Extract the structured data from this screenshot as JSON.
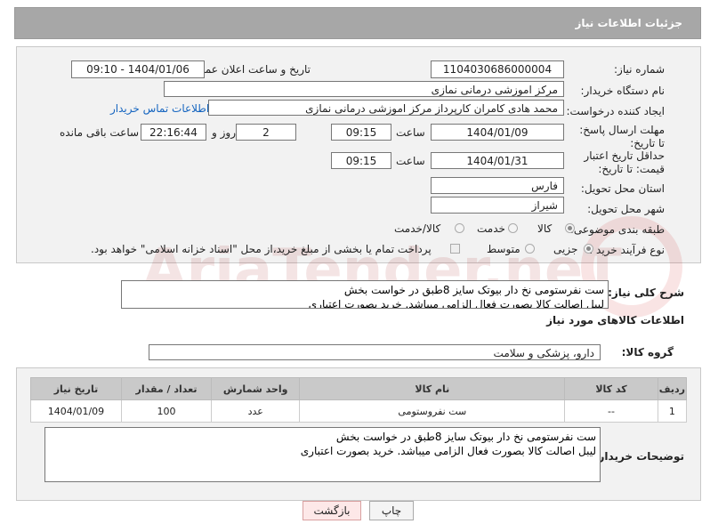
{
  "header": {
    "title": "جزئیات اطلاعات نیاز"
  },
  "form": {
    "need_number_label": "شماره نیاز:",
    "need_number": "1104030686000004",
    "announce_label": "تاریخ و ساعت اعلان عمومی:",
    "announce_value": "1404/01/06 - 09:10",
    "buyer_org_label": "نام دستگاه خریدار:",
    "buyer_org": "مرکز اموزشی درمانی نمازی",
    "creator_label": "ایجاد کننده درخواست:",
    "creator": "محمد هادی کامران کارپرداز مرکز اموزشی درمانی نمازی",
    "contact_link": "اطلاعات تماس خریدار",
    "reply_deadline_label": "مهلت ارسال پاسخ: تا تاریخ:",
    "reply_date": "1404/01/09",
    "time_label": "ساعت",
    "reply_time": "09:15",
    "days_count": "2",
    "days_and_label": "روز و",
    "remaining_time": "22:16:44",
    "remaining_label": "ساعت باقی مانده",
    "price_validity_label": "حداقل تاریخ اعتبار قیمت: تا تاریخ:",
    "price_date": "1404/01/31",
    "price_time": "09:15",
    "province_label": "استان محل تحویل:",
    "province": "فارس",
    "city_label": "شهر محل تحویل:",
    "city": "شیراز",
    "category_label": "طبقه بندی موضوعی:",
    "category_options": [
      "کالا",
      "خدمت",
      "کالا/خدمت"
    ],
    "process_label": "نوع فرآیند خرید :",
    "process_options": [
      "جزیی",
      "متوسط"
    ],
    "payment_note": "پرداخت تمام یا بخشی از مبلغ خرید،از محل \"اسناد خزانه اسلامی\" خواهد بود."
  },
  "general_desc": {
    "label": "شرح کلی نیاز:",
    "text": "ست نفرستومی نخ دار بیوتک سایز 8طبق در خواست بخش\nلیبل اصالت کالا بصورت فعال الزامی میباشد. خرید بصورت اعتباری"
  },
  "goods_info": {
    "title": "اطلاعات کالاهای مورد نیاز",
    "group_label": "گروه کالا:",
    "group_value": "دارو، پزشکی و سلامت"
  },
  "table": {
    "headers": [
      "ردیف",
      "کد کالا",
      "نام کالا",
      "واحد شمارش",
      "تعداد / مقدار",
      "تاریخ نیاز"
    ],
    "rows": [
      [
        "1",
        "--",
        "ست نفروستومی",
        "عدد",
        "100",
        "1404/01/09"
      ]
    ]
  },
  "buyer_desc": {
    "label": "توضیحات خریدار:",
    "text": "ست نفرستومی نخ دار بیوتک سایز 8طبق در خواست بخش\nلیبل اصالت کالا بصورت فعال الزامی میباشد. خرید بصورت اعتباری"
  },
  "buttons": {
    "print": "چاپ",
    "back": "بازگشت"
  },
  "watermark": {
    "text": "AriaTender.neT"
  },
  "colors": {
    "header": "#a7a7a7",
    "link": "#1565c0",
    "back_button": "#fde8e8"
  }
}
